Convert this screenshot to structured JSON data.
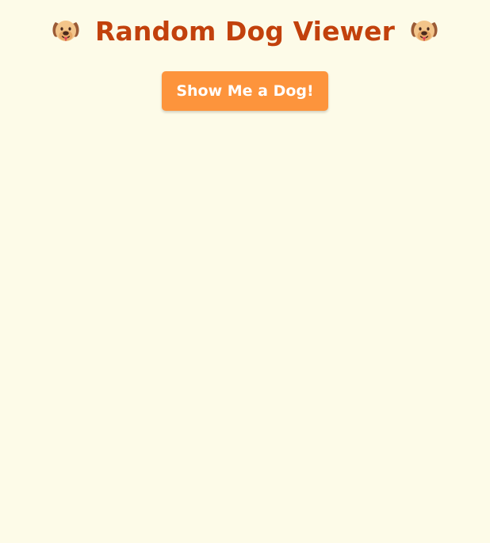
{
  "page": {
    "title": "Random Dog Viewer",
    "left_emoji_icon": "dog-face-icon",
    "right_emoji_icon": "dog-face-icon",
    "button_label": "Show Me a Dog!"
  },
  "colors": {
    "background": "#fdfbe8",
    "title": "#c2410c",
    "button": "#fd943c",
    "button_text": "#ffffff"
  }
}
